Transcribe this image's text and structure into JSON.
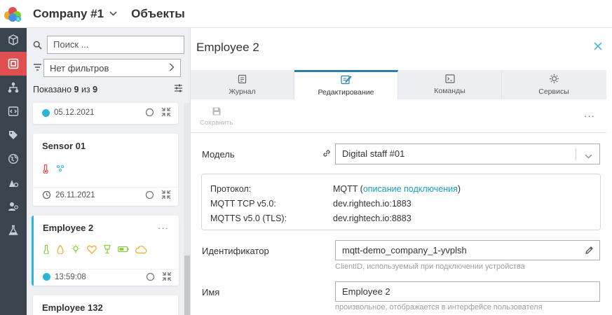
{
  "header": {
    "company": "Company #1",
    "page_title": "Объекты"
  },
  "leftnav": {
    "items": [
      "cube-icon",
      "objects-icon",
      "hierarchy-icon",
      "code-icon",
      "tag-icon",
      "globe-icon",
      "rocket-icon",
      "users-icon",
      "flask-icon"
    ],
    "active_index": 1,
    "active_color": "#e04f4f"
  },
  "list": {
    "search_placeholder": "Поиск ...",
    "filter_text": "Нет фильтров",
    "shown_prefix": "Показано",
    "shown_count": "9",
    "shown_mid": "из",
    "shown_total": "9",
    "cards": [
      {
        "title": "",
        "time": "05.12.2021",
        "status": "online"
      },
      {
        "title": "Sensor 01",
        "time": "26.11.2021",
        "status": "clock",
        "sensors": [
          "thermometer-icon",
          "humidity-icon"
        ]
      },
      {
        "title": "Employee 2",
        "time": "13:59:08",
        "status": "online",
        "more": "···",
        "sensors": [
          "thermometer-icon",
          "drop-icon",
          "light-icon",
          "heart-icon",
          "glass-icon",
          "battery-icon",
          "cloud-icon"
        ]
      },
      {
        "title": "Employee 132"
      }
    ]
  },
  "detail": {
    "title": "Employee 2",
    "tabs": [
      {
        "label": "Журнал",
        "icon": "journal-icon"
      },
      {
        "label": "Редактирование",
        "icon": "edit-icon",
        "active": true
      },
      {
        "label": "Команды",
        "icon": "terminal-icon"
      },
      {
        "label": "Сервисы",
        "icon": "services-icon"
      }
    ],
    "toolbar": {
      "save_label": "Сохранить",
      "more": "···"
    },
    "model": {
      "label": "Модель",
      "value": "Digital staff #01"
    },
    "protocol": {
      "rows": [
        {
          "label": "Протокол:",
          "value": "MQTT",
          "link_open": " (",
          "link": "описание подключения",
          "link_close": ")"
        },
        {
          "label": "MQTT TCP v5.0:",
          "value": "dev.rightech.io:1883"
        },
        {
          "label": "MQTTS v5.0 (TLS):",
          "value": "dev.rightech.io:8883"
        }
      ]
    },
    "identifier": {
      "label": "Идентификатор",
      "value": "mqtt-demo_company_1-yvplsh",
      "hint": "ClientID, используемый при подключении устройства"
    },
    "name": {
      "label": "Имя",
      "value": "Employee 2",
      "hint": "произвольное, отображается в интерфейсе пользователя"
    },
    "accent_color": "#2bb6d6",
    "link_color": "#1a9cbf"
  }
}
